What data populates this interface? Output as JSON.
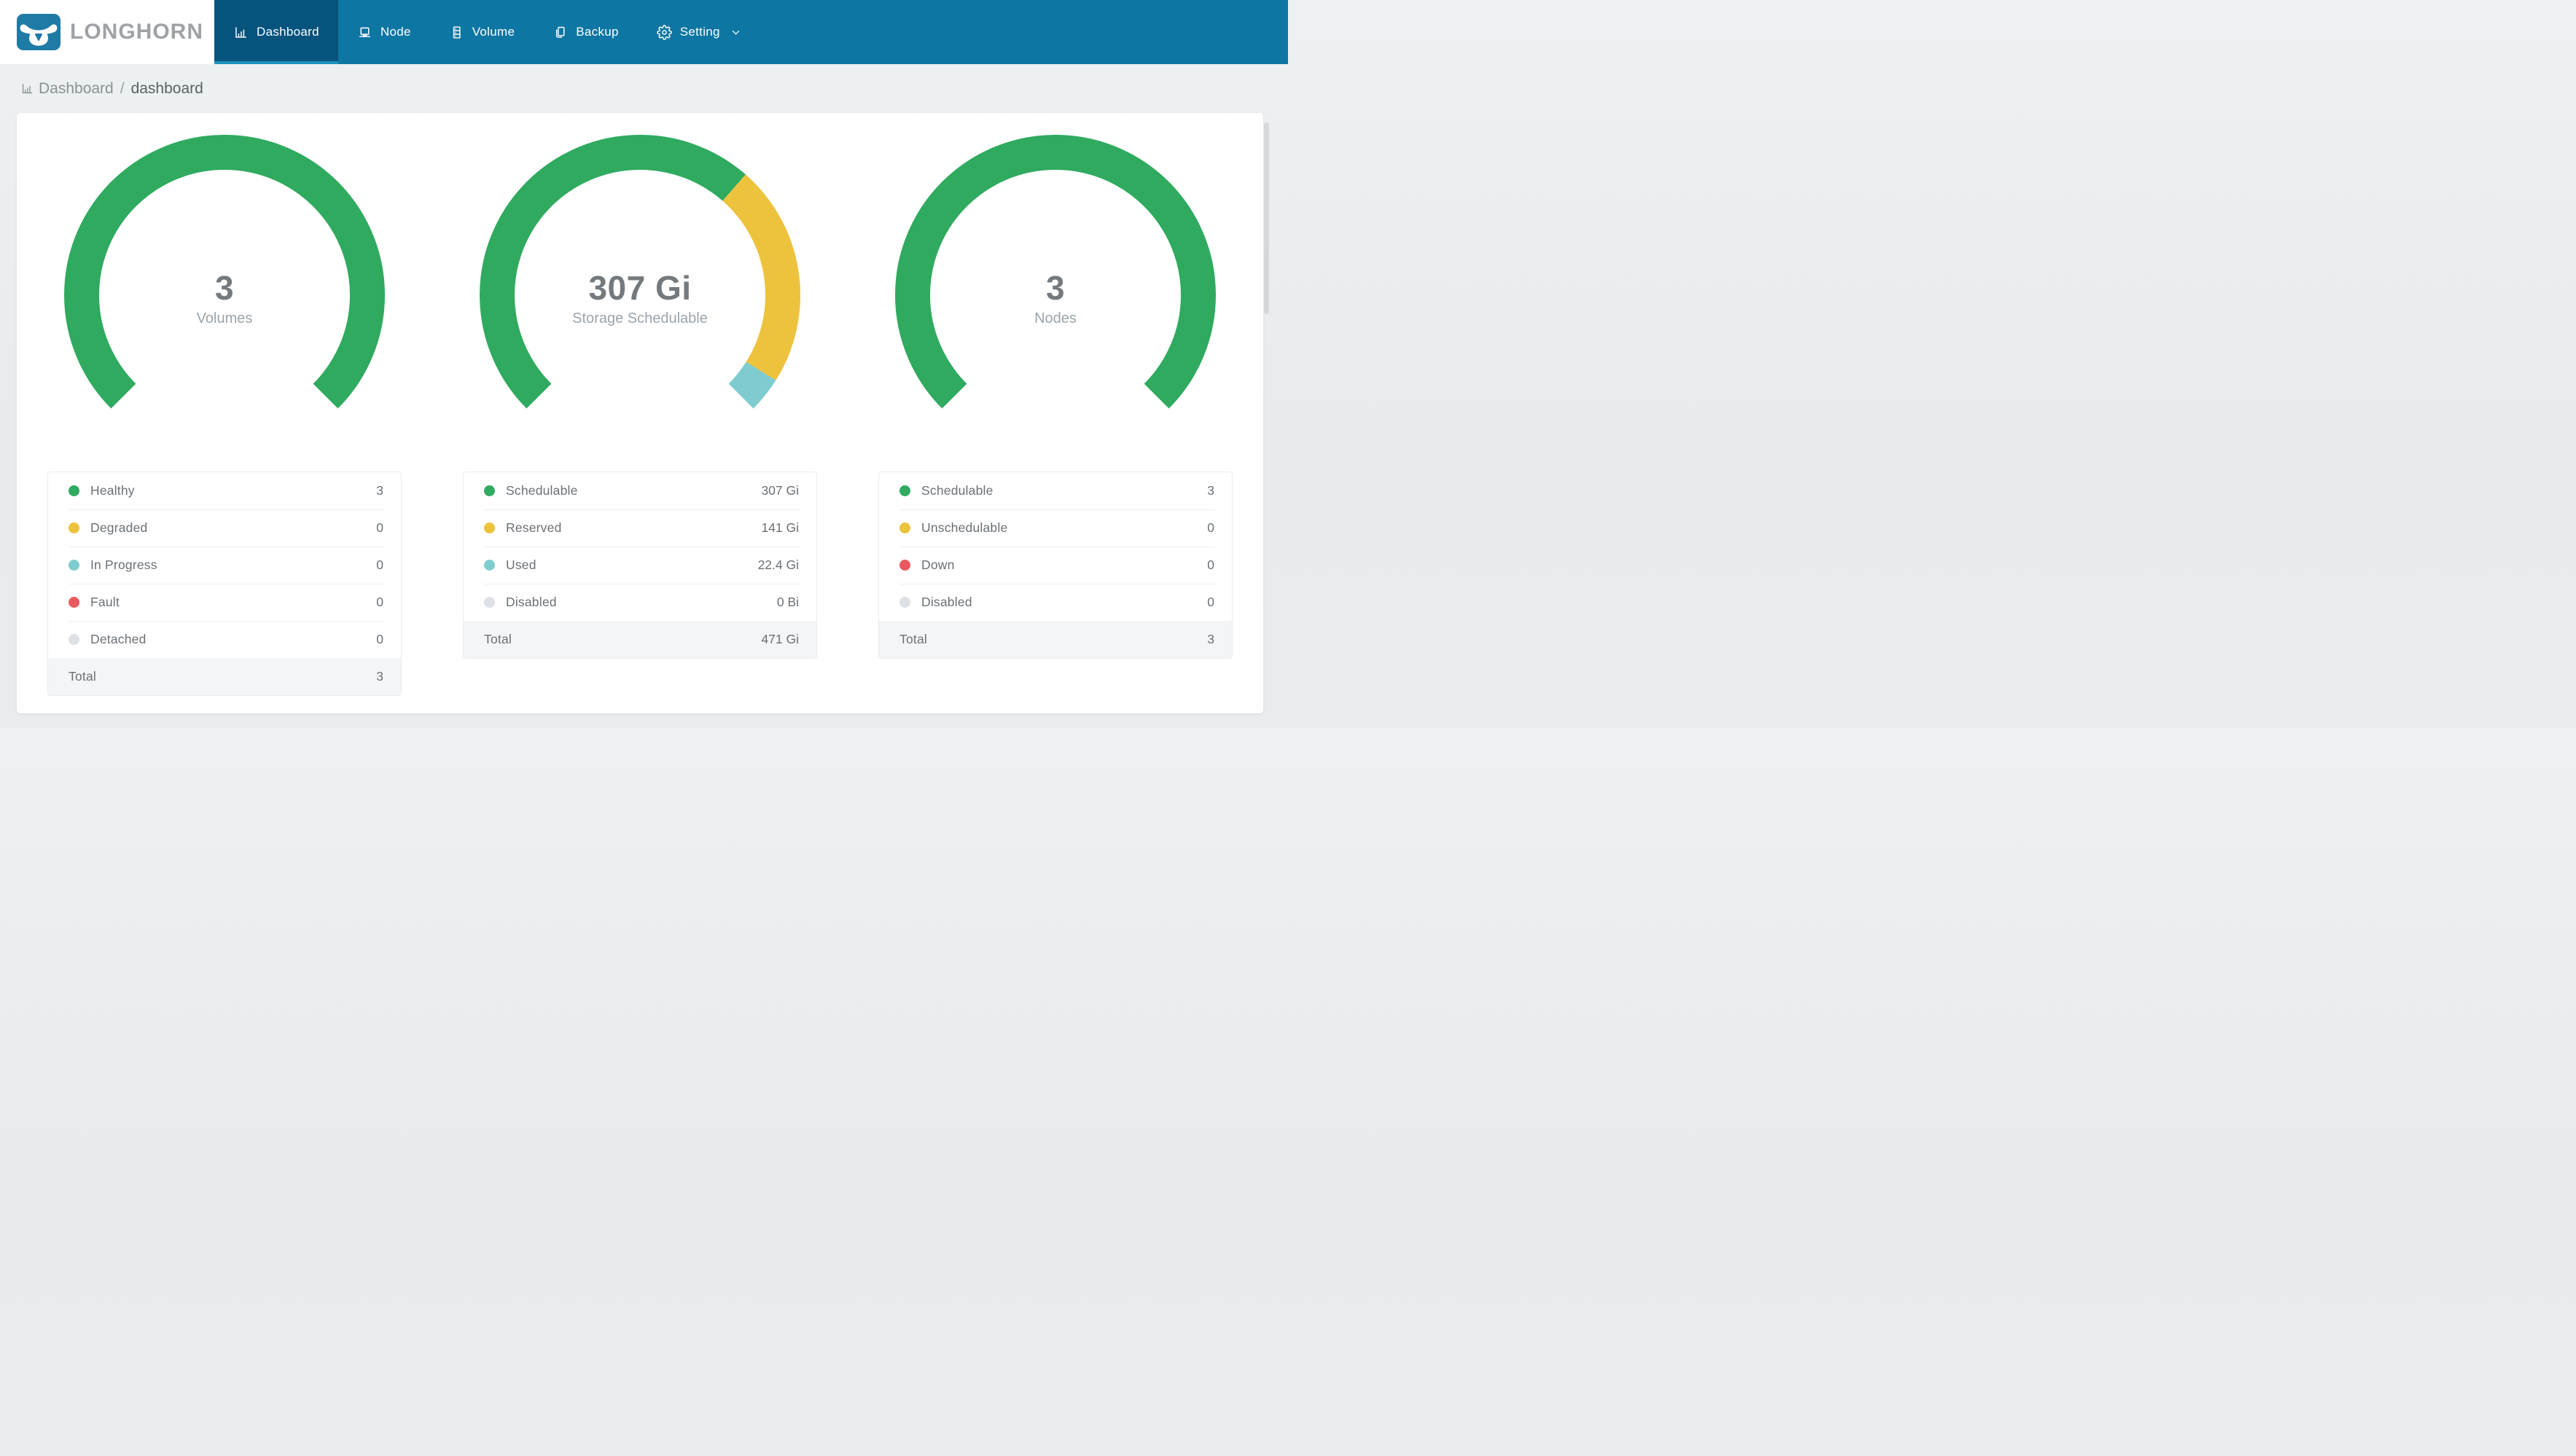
{
  "brand": {
    "name": "LONGHORN"
  },
  "nav": {
    "items": [
      {
        "label": "Dashboard",
        "icon": "bar-chart-icon",
        "active": true
      },
      {
        "label": "Node",
        "icon": "laptop-icon",
        "active": false
      },
      {
        "label": "Volume",
        "icon": "server-icon",
        "active": false
      },
      {
        "label": "Backup",
        "icon": "copy-icon",
        "active": false
      },
      {
        "label": "Setting",
        "icon": "gear-icon",
        "active": false,
        "has_dropdown": true
      }
    ]
  },
  "breadcrumb": {
    "section": "Dashboard",
    "separator": "/",
    "page": "dashboard"
  },
  "colors": {
    "navbar": "#0d76a2",
    "navbar_active": "#06537d",
    "active_underline": "#1d93bd",
    "logo_blue": "#1e7ba6",
    "green": "#2faa5f",
    "yellow": "#edc23d",
    "teal": "#7fccd0",
    "red": "#e9595f",
    "gray": "#dde1e5",
    "page_bg": "#eaedef"
  },
  "chart_data": [
    {
      "type": "gauge",
      "title": "Volumes",
      "center_value": "3",
      "center_label": "Volumes",
      "start_angle": 225,
      "sweep": 270,
      "rows": [
        {
          "label": "Healthy",
          "value": 3,
          "display": "3",
          "color": "#2faa5f"
        },
        {
          "label": "Degraded",
          "value": 0,
          "display": "0",
          "color": "#edc23d"
        },
        {
          "label": "In Progress",
          "value": 0,
          "display": "0",
          "color": "#7fccd0"
        },
        {
          "label": "Fault",
          "value": 0,
          "display": "0",
          "color": "#e9595f"
        },
        {
          "label": "Detached",
          "value": 0,
          "display": "0",
          "color": "#dde1e5"
        }
      ],
      "total": {
        "label": "Total",
        "display": "3"
      }
    },
    {
      "type": "gauge",
      "title": "Storage Schedulable",
      "center_value": "307 Gi",
      "center_label": "Storage Schedulable",
      "start_angle": 225,
      "sweep": 270,
      "rows": [
        {
          "label": "Schedulable",
          "value": 307,
          "display": "307 Gi",
          "color": "#2faa5f"
        },
        {
          "label": "Reserved",
          "value": 141,
          "display": "141 Gi",
          "color": "#edc23d"
        },
        {
          "label": "Used",
          "value": 22.4,
          "display": "22.4 Gi",
          "color": "#7fccd0"
        },
        {
          "label": "Disabled",
          "value": 0,
          "display": "0 Bi",
          "color": "#dde1e5"
        }
      ],
      "total": {
        "label": "Total",
        "display": "471 Gi"
      }
    },
    {
      "type": "gauge",
      "title": "Nodes",
      "center_value": "3",
      "center_label": "Nodes",
      "start_angle": 225,
      "sweep": 270,
      "rows": [
        {
          "label": "Schedulable",
          "value": 3,
          "display": "3",
          "color": "#2faa5f"
        },
        {
          "label": "Unschedulable",
          "value": 0,
          "display": "0",
          "color": "#edc23d"
        },
        {
          "label": "Down",
          "value": 0,
          "display": "0",
          "color": "#e9595f"
        },
        {
          "label": "Disabled",
          "value": 0,
          "display": "0",
          "color": "#dde1e5"
        }
      ],
      "total": {
        "label": "Total",
        "display": "3"
      }
    }
  ]
}
